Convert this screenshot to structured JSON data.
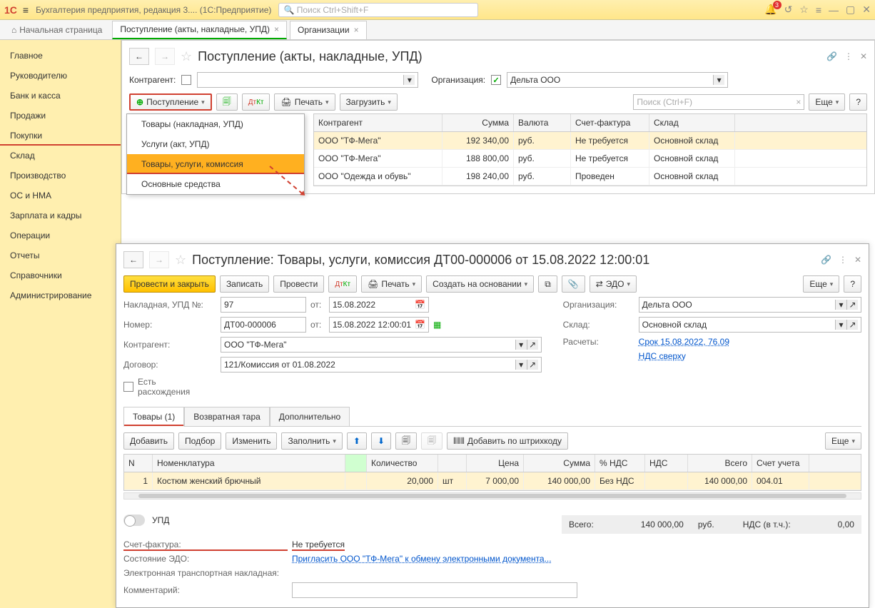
{
  "titlebar": {
    "app_title": "Бухгалтерия предприятия, редакция 3....   (1С:Предприятие)",
    "search_placeholder": "Поиск Ctrl+Shift+F",
    "notification_count": "3"
  },
  "tabs": {
    "home": "Начальная страница",
    "items": [
      {
        "label": "Поступление (акты, накладные, УПД)",
        "active": true
      },
      {
        "label": "Организации",
        "active": false
      }
    ]
  },
  "sidebar": {
    "items": [
      "Главное",
      "Руководителю",
      "Банк и касса",
      "Продажи",
      "Покупки",
      "Склад",
      "Производство",
      "ОС и НМА",
      "Зарплата и кадры",
      "Операции",
      "Отчеты",
      "Справочники",
      "Администрирование"
    ],
    "active_index": 4
  },
  "panel1": {
    "title": "Поступление (акты, накладные, УПД)",
    "filter": {
      "counterparty_label": "Контрагент:",
      "org_label": "Организация:",
      "org_value": "Дельта ООО"
    },
    "toolbar": {
      "add_label": "Поступление",
      "print_label": "Печать",
      "load_label": "Загрузить",
      "search_placeholder": "Поиск (Ctrl+F)",
      "more_label": "Еще"
    },
    "dropdown_items": [
      "Товары (накладная, УПД)",
      "Услуги (акт, УПД)",
      "Товары, услуги, комиссия",
      "Основные средства"
    ],
    "dropdown_selected": 2,
    "grid": {
      "columns": [
        "Контрагент",
        "Сумма",
        "Валюта",
        "Счет-фактура",
        "Склад"
      ],
      "rows": [
        [
          "ООО \"ТФ-Мега\"",
          "192 340,00",
          "руб.",
          "Не требуется",
          "Основной склад"
        ],
        [
          "ООО \"ТФ-Мега\"",
          "188 800,00",
          "руб.",
          "Не требуется",
          "Основной склад"
        ],
        [
          "ООО \"Одежда и обувь\"",
          "198 240,00",
          "руб.",
          "Проведен",
          "Основной склад"
        ]
      ]
    }
  },
  "panel2": {
    "title": "Поступление: Товары, услуги, комиссия ДТ00-000006 от 15.08.2022 12:00:01",
    "toolbar": {
      "post_close": "Провести и закрыть",
      "save": "Записать",
      "post": "Провести",
      "print": "Печать",
      "create_based": "Создать на основании",
      "edo": "ЭДО",
      "more": "Еще"
    },
    "form": {
      "invoice_label": "Накладная, УПД №:",
      "invoice_no": "97",
      "from_label": "от:",
      "invoice_date": "15.08.2022",
      "number_label": "Номер:",
      "number": "ДТ00-000006",
      "number_date": "15.08.2022 12:00:01",
      "counterparty_label": "Контрагент:",
      "counterparty": "ООО \"ТФ-Мега\"",
      "contract_label": "Договор:",
      "contract": "121/Комиссия от 01.08.2022",
      "org_label": "Организация:",
      "org": "Дельта ООО",
      "warehouse_label": "Склад:",
      "warehouse": "Основной склад",
      "calc_label": "Расчеты:",
      "calc_link": "Срок 15.08.2022, 76.09",
      "vat_link": "НДС сверху",
      "discrepancy_label": "Есть расхождения"
    },
    "tabs": [
      "Товары (1)",
      "Возвратная тара",
      "Дополнительно"
    ],
    "item_toolbar": {
      "add": "Добавить",
      "pick": "Подбор",
      "edit": "Изменить",
      "fill": "Заполнить",
      "barcode": "Добавить по штрихкоду",
      "more": "Еще"
    },
    "item_grid": {
      "columns": [
        "N",
        "Номенклатура",
        "",
        "Количество",
        "",
        "Цена",
        "Сумма",
        "% НДС",
        "НДС",
        "Всего",
        "Счет учета"
      ],
      "row": [
        "1",
        "Костюм женский брючный",
        "",
        "20,000",
        "шт",
        "7 000,00",
        "140 000,00",
        "Без НДС",
        "",
        "140 000,00",
        "004.01"
      ]
    },
    "totals": {
      "upd_label": "УПД",
      "total_label": "Всего:",
      "total": "140 000,00",
      "currency": "руб.",
      "vat_label": "НДС (в т.ч.):",
      "vat": "0,00"
    },
    "footer": {
      "invoice_fact_label": "Счет-фактура:",
      "invoice_fact_value": "Не требуется",
      "edo_state_label": "Состояние ЭДО:",
      "edo_link": "Пригласить ООО \"ТФ-Мега\" к обмену электронными документа...",
      "etn_label": "Электронная транспортная накладная:",
      "comment_label": "Комментарий:"
    }
  }
}
